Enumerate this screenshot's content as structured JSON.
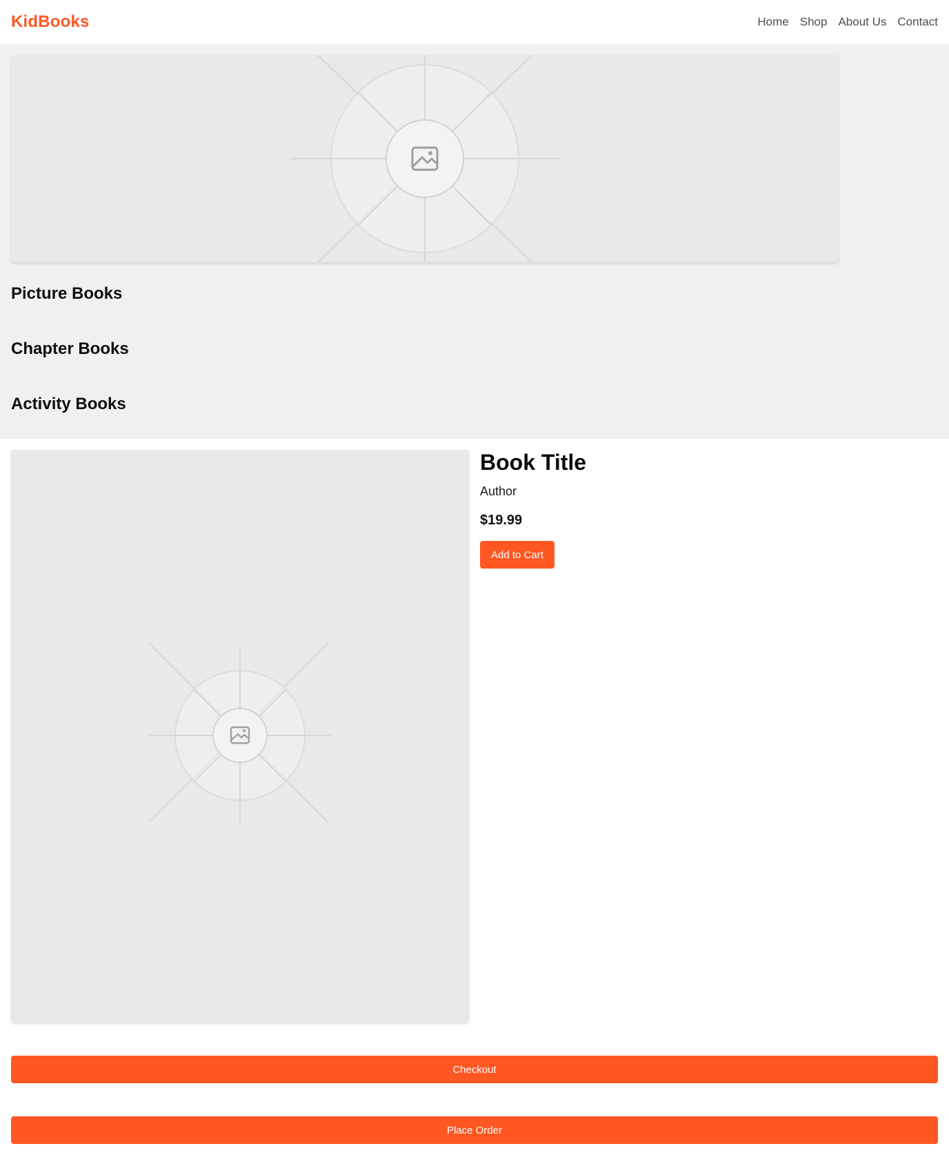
{
  "colors": {
    "accent": "#ff5722",
    "page_bg": "#ffffff",
    "section_bg": "#f0f0f0",
    "placeholder_bg": "#e9e9e9",
    "nav_text": "#4a4f55"
  },
  "header": {
    "brand": "KidBooks",
    "nav": [
      {
        "label": "Home"
      },
      {
        "label": "Shop"
      },
      {
        "label": "About Us"
      },
      {
        "label": "Contact"
      }
    ]
  },
  "hero": {
    "icon": "image-placeholder-icon"
  },
  "categories": [
    {
      "label": "Picture Books"
    },
    {
      "label": "Chapter Books"
    },
    {
      "label": "Activity Books"
    }
  ],
  "product": {
    "cover_icon": "image-placeholder-icon",
    "title": "Book Title",
    "author": "Author",
    "price": "$19.99",
    "add_to_cart_label": "Add to Cart"
  },
  "actions": {
    "checkout_label": "Checkout",
    "place_order_label": "Place Order"
  }
}
